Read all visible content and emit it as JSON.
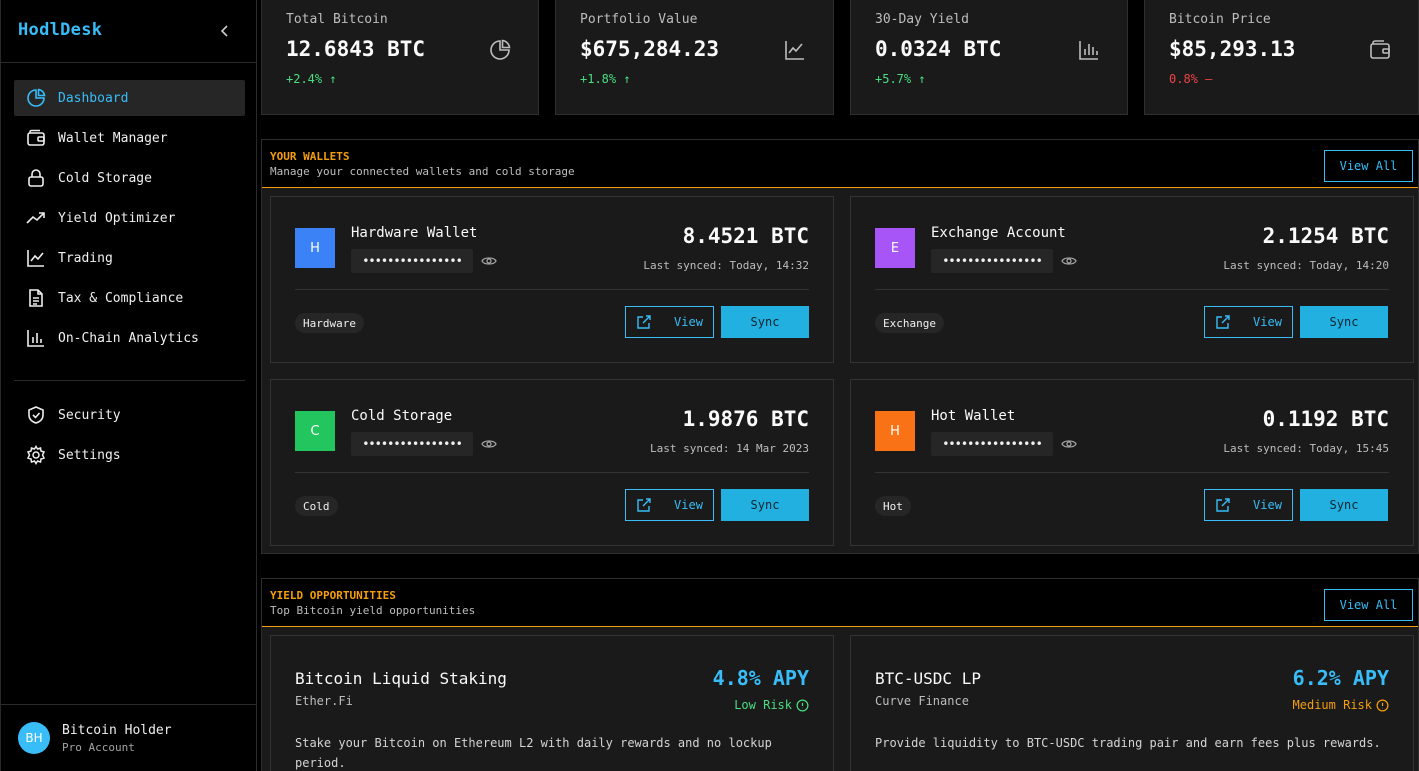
{
  "app": {
    "brand": "HodlDesk"
  },
  "sidebar": {
    "nav": [
      {
        "label": "Dashboard",
        "icon": "pie-chart-icon",
        "active": true
      },
      {
        "label": "Wallet Manager",
        "icon": "wallet-icon"
      },
      {
        "label": "Cold Storage",
        "icon": "lock-icon"
      },
      {
        "label": "Yield Optimizer",
        "icon": "trending-up-icon"
      },
      {
        "label": "Trading",
        "icon": "line-chart-icon"
      },
      {
        "label": "Tax & Compliance",
        "icon": "document-icon"
      },
      {
        "label": "On-Chain Analytics",
        "icon": "bar-chart-icon"
      }
    ],
    "secondary": [
      {
        "label": "Security",
        "icon": "shield-icon"
      },
      {
        "label": "Settings",
        "icon": "gear-icon"
      }
    ],
    "user": {
      "initials": "BH",
      "name": "Bitcoin Holder",
      "role": "Pro Account"
    }
  },
  "stats": [
    {
      "label": "Total Bitcoin",
      "value": "12.6843 BTC",
      "change": "+2.4% ↑",
      "trend": "up",
      "icon": "pie-chart-icon"
    },
    {
      "label": "Portfolio Value",
      "value": "$675,284.23",
      "change": "+1.8% ↑",
      "trend": "up",
      "icon": "line-chart-icon"
    },
    {
      "label": "30-Day Yield",
      "value": "0.0324 BTC",
      "change": "+5.7% ↑",
      "trend": "up",
      "icon": "bar-chart-icon"
    },
    {
      "label": "Bitcoin Price",
      "value": "$85,293.13",
      "change": "0.8% —",
      "trend": "down",
      "icon": "wallet-icon"
    }
  ],
  "wallets": {
    "title": "YOUR WALLETS",
    "subtitle": "Manage your connected wallets and cold storage",
    "view_all": "View All",
    "view_label": "View",
    "sync_label": "Sync",
    "items": [
      {
        "initial": "H",
        "color": "#3b82f6",
        "name": "Hardware Wallet",
        "address_mask": "••••••••••••••••",
        "balance": "8.4521 BTC",
        "synced": "Last synced: Today, 14:32",
        "tag": "Hardware"
      },
      {
        "initial": "E",
        "color": "#a855f7",
        "name": "Exchange Account",
        "address_mask": "••••••••••••••••",
        "balance": "2.1254 BTC",
        "synced": "Last synced: Today, 14:20",
        "tag": "Exchange"
      },
      {
        "initial": "C",
        "color": "#22c55e",
        "name": "Cold Storage",
        "address_mask": "••••••••••••••••",
        "balance": "1.9876 BTC",
        "synced": "Last synced: 14 Mar 2023",
        "tag": "Cold"
      },
      {
        "initial": "H",
        "color": "#f97316",
        "name": "Hot Wallet",
        "address_mask": "••••••••••••••••",
        "balance": "0.1192 BTC",
        "synced": "Last synced: Today, 15:45",
        "tag": "Hot"
      }
    ]
  },
  "yield": {
    "title": "YIELD OPPORTUNITIES",
    "subtitle": "Top Bitcoin yield opportunities",
    "view_all": "View All",
    "items": [
      {
        "name": "Bitcoin Liquid Staking",
        "provider": "Ether.Fi",
        "apy": "4.8% APY",
        "risk": "Low Risk",
        "risk_color": "#4ade80",
        "description": "Stake your Bitcoin on Ethereum L2 with daily rewards and no lockup period."
      },
      {
        "name": "BTC-USDC LP",
        "provider": "Curve Finance",
        "apy": "6.2% APY",
        "risk": "Medium Risk",
        "risk_color": "#f59e0b",
        "description": "Provide liquidity to BTC-USDC trading pair and earn fees plus rewards."
      }
    ]
  }
}
